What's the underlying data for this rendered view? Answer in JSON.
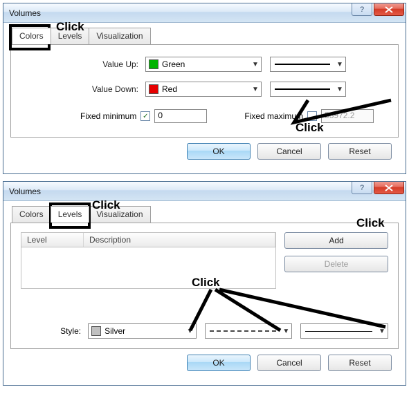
{
  "dialog1": {
    "title": "Volumes",
    "tabs": {
      "colors": "Colors",
      "levels": "Levels",
      "viz": "Visualization"
    },
    "value_up_label": "Value Up:",
    "value_up_color": "Green",
    "value_up_swatch": "#00b400",
    "value_down_label": "Value Down:",
    "value_down_color": "Red",
    "value_down_swatch": "#e60000",
    "fixed_min_label": "Fixed minimum",
    "fixed_min_checked": "✓",
    "fixed_min_value": "0",
    "fixed_max_label": "Fixed maximum",
    "fixed_max_value": "58972.2",
    "ok": "OK",
    "cancel": "Cancel",
    "reset": "Reset"
  },
  "dialog2": {
    "title": "Volumes",
    "tabs": {
      "colors": "Colors",
      "levels": "Levels",
      "viz": "Visualization"
    },
    "col_level": "Level",
    "col_desc": "Description",
    "add": "Add",
    "delete": "Delete",
    "style_label": "Style:",
    "style_color": "Silver",
    "style_swatch": "#c0c0c0",
    "ok": "OK",
    "cancel": "Cancel",
    "reset": "Reset"
  },
  "annotations": {
    "click": "Click"
  }
}
